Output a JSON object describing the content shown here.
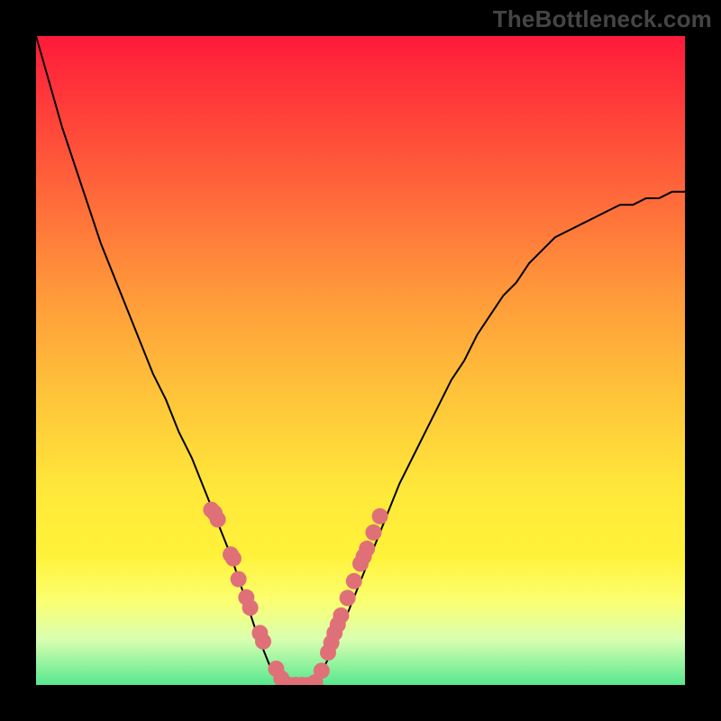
{
  "watermark": "TheBottleneck.com",
  "chart_data": {
    "type": "line",
    "title": "",
    "xlabel": "",
    "ylabel": "",
    "x": [
      0.0,
      0.02,
      0.04,
      0.06,
      0.08,
      0.1,
      0.12,
      0.14,
      0.16,
      0.18,
      0.2,
      0.22,
      0.24,
      0.26,
      0.28,
      0.3,
      0.32,
      0.34,
      0.36,
      0.38,
      0.4,
      0.42,
      0.44,
      0.46,
      0.48,
      0.5,
      0.52,
      0.54,
      0.56,
      0.58,
      0.6,
      0.62,
      0.64,
      0.66,
      0.68,
      0.7,
      0.72,
      0.74,
      0.76,
      0.78,
      0.8,
      0.82,
      0.84,
      0.86,
      0.88,
      0.9,
      0.92,
      0.94,
      0.96,
      0.98,
      1.0
    ],
    "values": [
      1.0,
      0.93,
      0.86,
      0.8,
      0.74,
      0.68,
      0.63,
      0.58,
      0.53,
      0.48,
      0.44,
      0.39,
      0.35,
      0.3,
      0.25,
      0.2,
      0.14,
      0.08,
      0.03,
      0.0,
      0.0,
      0.0,
      0.02,
      0.06,
      0.11,
      0.16,
      0.21,
      0.26,
      0.31,
      0.35,
      0.39,
      0.43,
      0.47,
      0.5,
      0.54,
      0.57,
      0.6,
      0.62,
      0.65,
      0.67,
      0.69,
      0.7,
      0.71,
      0.72,
      0.73,
      0.74,
      0.74,
      0.75,
      0.75,
      0.76,
      0.76
    ],
    "marker_points": {
      "x": [
        0.27,
        0.275,
        0.28,
        0.3,
        0.304,
        0.312,
        0.324,
        0.33,
        0.345,
        0.35,
        0.37,
        0.378,
        0.39,
        0.4,
        0.41,
        0.42,
        0.43,
        0.44,
        0.45,
        0.455,
        0.46,
        0.465,
        0.47,
        0.48,
        0.49,
        0.5,
        0.505,
        0.51,
        0.52,
        0.53
      ],
      "y": [
        0.27,
        0.265,
        0.255,
        0.201,
        0.195,
        0.163,
        0.135,
        0.119,
        0.08,
        0.067,
        0.025,
        0.01,
        0.0,
        0.0,
        0.0,
        0.0,
        0.004,
        0.022,
        0.05,
        0.065,
        0.08,
        0.093,
        0.107,
        0.134,
        0.16,
        0.187,
        0.198,
        0.21,
        0.235,
        0.26
      ]
    },
    "marker_color": "#e07078",
    "curve_color": "#000000",
    "xlim": [
      0,
      1
    ],
    "ylim": [
      0,
      1
    ],
    "grid": false,
    "legend": false
  }
}
